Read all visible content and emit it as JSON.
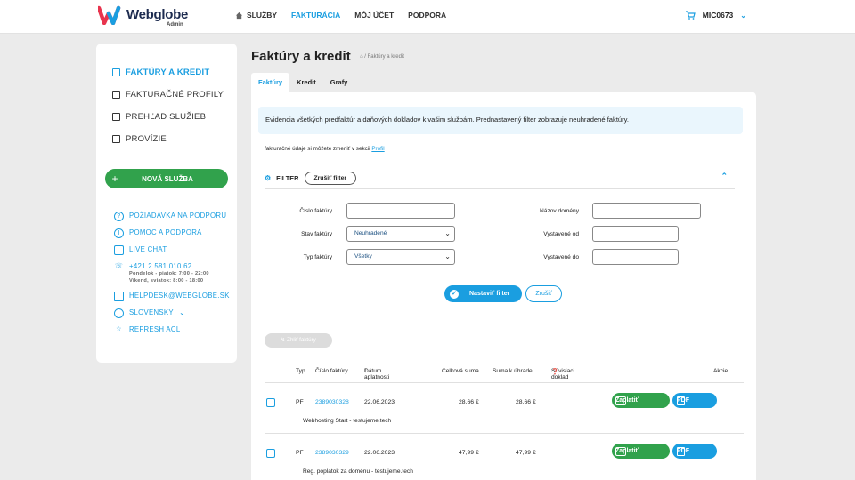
{
  "brand": {
    "name": "Webglobe",
    "sub": "Admin"
  },
  "nav": [
    {
      "label": "SLUŽBY",
      "icon": "home-icon"
    },
    {
      "label": "FAKTURÁCIA"
    },
    {
      "label": "MÔJ ÚČET"
    },
    {
      "label": "PODPORA"
    }
  ],
  "account": {
    "user": "MIC0673"
  },
  "sidebar": {
    "items": [
      "FAKTÚRY A KREDIT",
      "FAKTURAČNÉ PROFILY",
      "PREHĽAD SLUŽIEB",
      "PROVÍZIE"
    ],
    "new_service": "NOVÁ SLUŽBA",
    "contacts": {
      "ticket": "POŽIADAVKA NA PODPORU",
      "help": "POMOC A PODPORA",
      "chat": "LIVE CHAT",
      "phone": "+421 2 581 010 62",
      "hours1": "Pondelok - piatok: 7:00 - 22:00",
      "hours2": "Víkend, sviatok: 8:00 - 18:00",
      "email": "HELPDESK@WEBGLOBE.SK",
      "lang": "SLOVENSKY",
      "refresh": "REFRESH ACL"
    }
  },
  "page": {
    "title": "Faktúry a kredit",
    "crumb": "/ Faktúry a kredit"
  },
  "tabs": [
    "Faktúry",
    "Kredit",
    "Grafy"
  ],
  "info": "Evidencia všetkých predfaktúr a daňových dokladov k vašim službám. Prednastavený filter zobrazuje neuhradené faktúry.",
  "note": {
    "text": "fakturačné údaje si môžete zmeniť v sekcii",
    "link": "Profil"
  },
  "filter": {
    "label": "FILTER",
    "clear": "Zrušiť filter",
    "invoice_no": "Číslo faktúry",
    "status": "Stav faktúry",
    "status_value": "Neuhradené",
    "type": "Typ faktúry",
    "type_value": "Všetky",
    "domain": "Názov domény",
    "issued_from": "Vystavené od",
    "issued_to": "Vystavené do",
    "apply": "Nastaviť filter",
    "cancel": "Zrušiť"
  },
  "hide_invoices": "Zhliť faktúry",
  "table": {
    "headers": [
      "Typ",
      "Číslo faktúry",
      "Dátum aplatnosti",
      "Celková suma",
      "Suma k úhrade",
      "Súvisiaci doklad",
      "Akcie"
    ],
    "sort_marker": "↑",
    "rows": [
      {
        "type": "PF",
        "number": "2389030328",
        "date": "22.06.2023",
        "total": "28,66 €",
        "due": "28,66 €",
        "desc": "Webhosting Start - testujeme.tech",
        "pay": "Zaplatiť",
        "pdf": "PDF"
      },
      {
        "type": "PF",
        "number": "2389030329",
        "date": "22.06.2023",
        "total": "47,99 €",
        "due": "47,99 €",
        "desc": "Reg. poplatok za doménu - testujeme.tech",
        "pay": "Zaplatiť",
        "pdf": "PDF"
      }
    ]
  },
  "colors": {
    "accent": "#1a9ee0",
    "green": "#31a24c"
  }
}
